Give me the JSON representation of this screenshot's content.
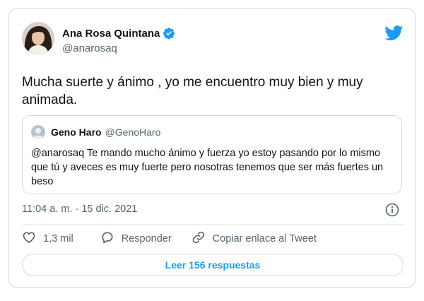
{
  "author": {
    "name": "Ana Rosa Quintana",
    "handle": "@anarosaq"
  },
  "tweet": {
    "text": "Mucha suerte y ánimo , yo me encuentro muy bien y muy animada."
  },
  "quoted_tweet": {
    "name": "Geno Haro",
    "handle": "@GenoHaro",
    "text": "@anarosaq Te mando mucho ánimo y fuerza yo estoy pasando por lo mismo que tú   y aveces es muy fuerte   pero nosotras tenemos que ser más fuertes un beso"
  },
  "meta": {
    "timestamp": "11:04 a. m. · 15 dic. 2021"
  },
  "actions": {
    "like_count": "1,3 mil",
    "reply_label": "Responder",
    "copy_link_label": "Copiar enlace al Tweet"
  },
  "replies_button": {
    "label": "Leer 156 respuestas"
  },
  "colors": {
    "accent": "#1d9bf0",
    "text_primary": "#0f1419",
    "text_secondary": "#536471",
    "border": "#cfd9de"
  },
  "icons": [
    "avatar",
    "verified-badge-icon",
    "twitter-bird-icon",
    "info-icon",
    "heart-icon",
    "reply-icon",
    "link-icon"
  ]
}
